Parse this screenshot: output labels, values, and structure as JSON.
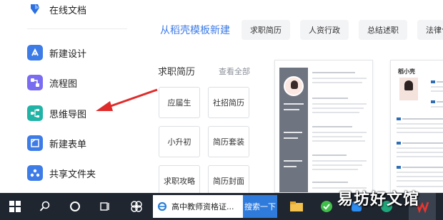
{
  "sidebar": {
    "top_item": "在线文档",
    "items": [
      {
        "label": "新建设计",
        "icon": "design-icon",
        "color": "#3d7be6"
      },
      {
        "label": "流程图",
        "icon": "flowchart-icon",
        "color": "#7a6cf0"
      },
      {
        "label": "思维导图",
        "icon": "mindmap-icon",
        "color": "#22b3a7"
      },
      {
        "label": "新建表单",
        "icon": "form-icon",
        "color": "#3d7be6"
      },
      {
        "label": "共享文件夹",
        "icon": "shared-folder-icon",
        "color": "#3d7be6"
      }
    ]
  },
  "main": {
    "title": "从稻壳模板新建",
    "chips": [
      "求职简历",
      "人资行政",
      "总结述职",
      "法律合"
    ],
    "section_title": "求职简历",
    "see_all": "查看全部",
    "categories": [
      "应届生",
      "社招简历",
      "小升初",
      "简历套装",
      "求职攻略",
      "简历封面"
    ],
    "thumb2_name": "稻小壳"
  },
  "taskbar": {
    "search_text": "高中教师资格证...",
    "search_button": "搜索一下"
  },
  "watermark": "易坊好文馆",
  "colors": {
    "accent": "#3d7be6",
    "arrow": "#e02b2b",
    "taskbar": "#1f2630"
  }
}
